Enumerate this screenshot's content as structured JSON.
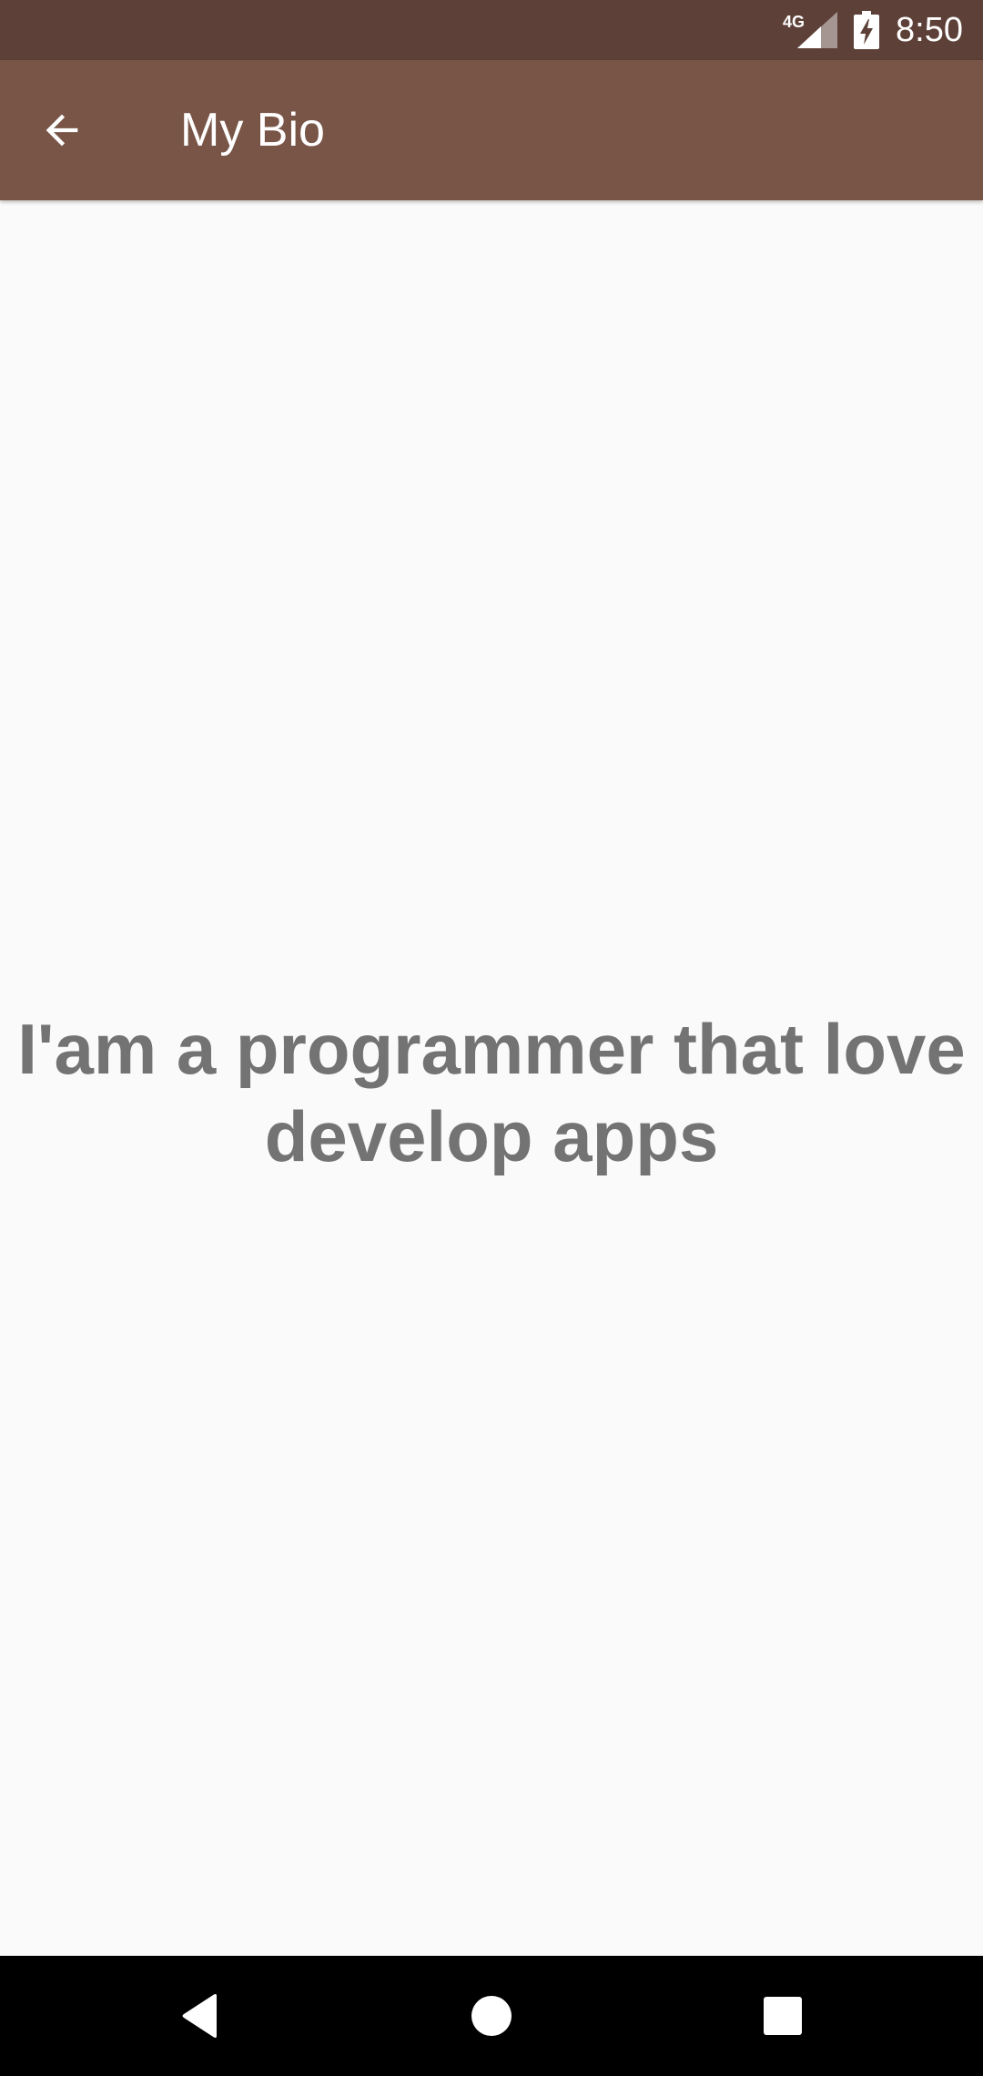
{
  "status_bar": {
    "network_type": "4G",
    "time": "8:50",
    "icons": [
      "signal-icon",
      "battery-charging-icon"
    ],
    "background_color": "#5d4037"
  },
  "app_bar": {
    "title": "My Bio",
    "back_icon": "arrow-left-icon",
    "background_color": "#795548"
  },
  "main": {
    "bio_text": "I'am a programmer that love develop apps",
    "text_color": "#737373",
    "background_color": "#fafafa"
  },
  "nav_bar": {
    "icons": [
      "nav-back-icon",
      "nav-home-icon",
      "nav-recents-icon"
    ],
    "background_color": "#000000"
  }
}
